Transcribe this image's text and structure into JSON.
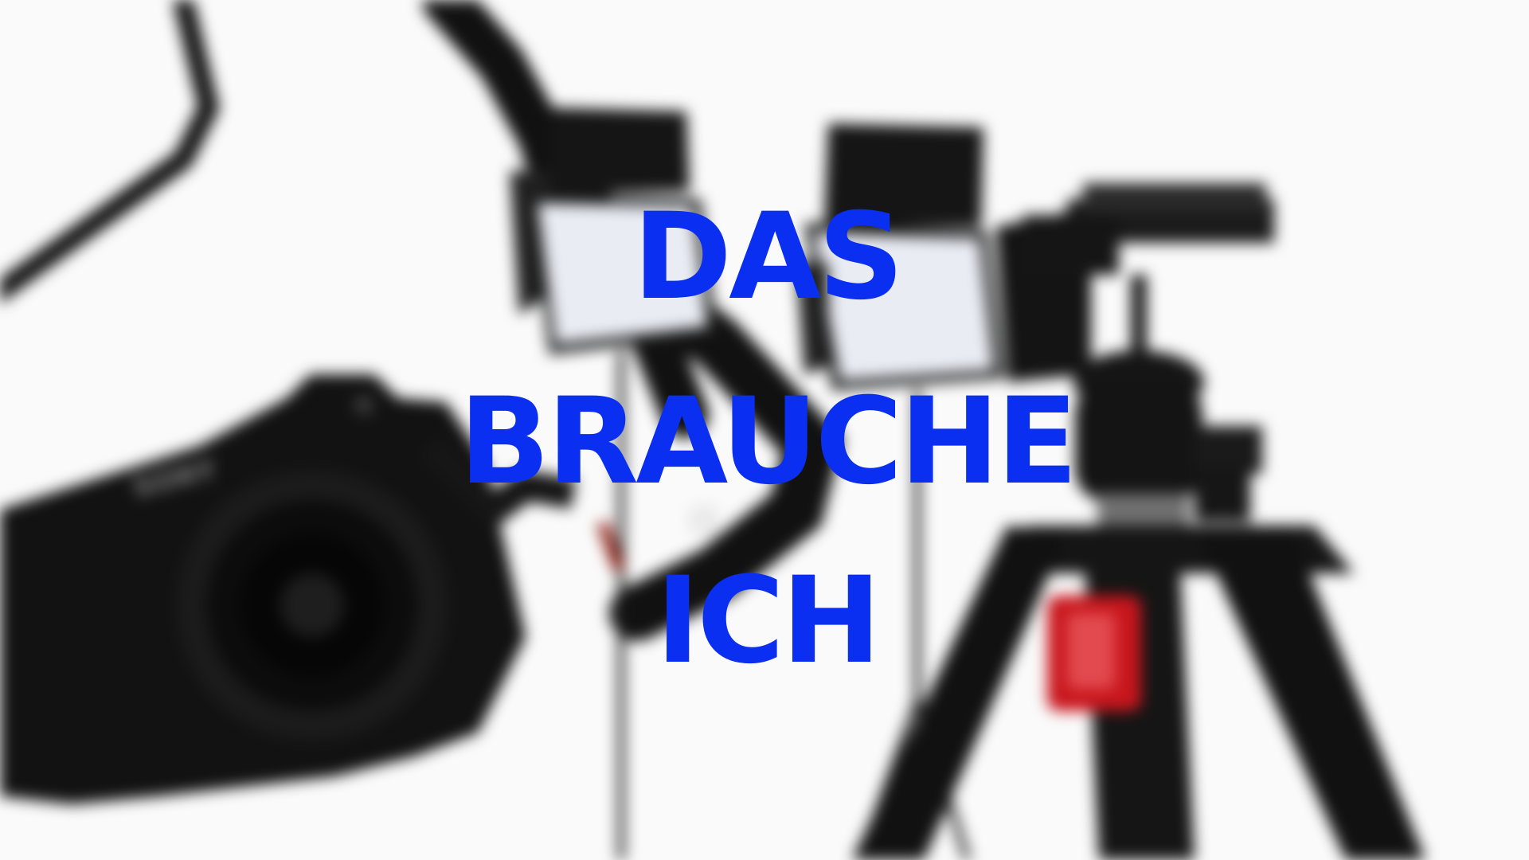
{
  "title": {
    "lines": [
      "DAS",
      "BRAUCHE",
      "ICH"
    ],
    "color": "#0a2ff0"
  },
  "camera": {
    "brand_label": "SONY",
    "alpha_mark": "α"
  },
  "colors": {
    "background": "#fafafa",
    "equipment": "#111111",
    "tripod_clip": "#c8161d",
    "panel_light": "#e9ecf3"
  }
}
